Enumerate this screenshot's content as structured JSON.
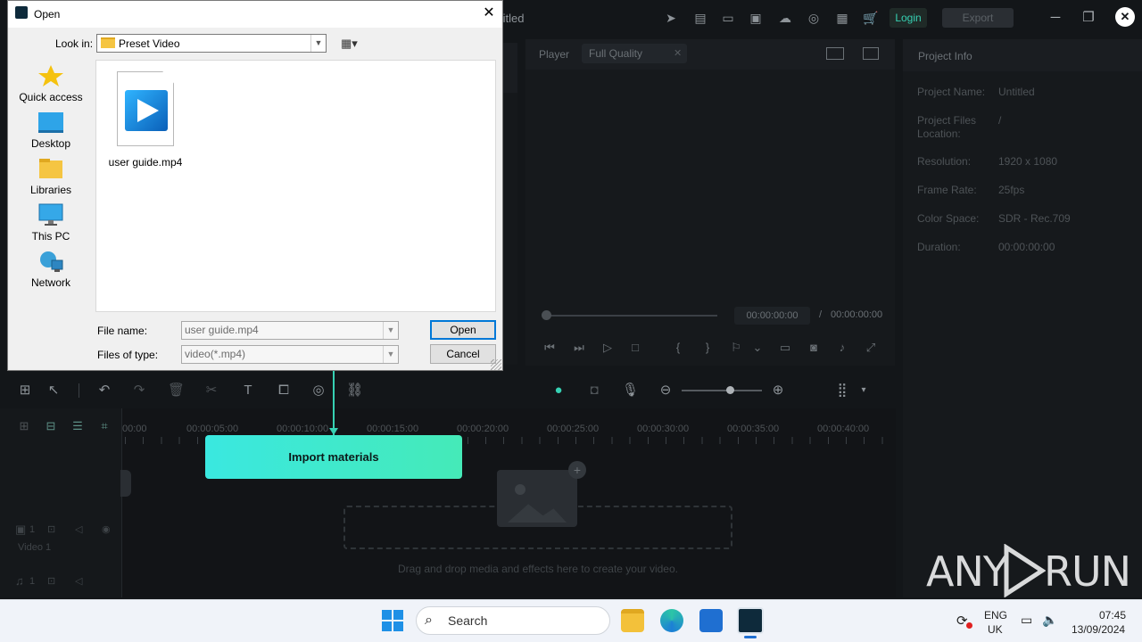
{
  "app": {
    "title_partial": "titled",
    "login_label": "Login",
    "export_label": "Export"
  },
  "player": {
    "label": "Player",
    "quality": "Full Quality",
    "current_time": "00:00:00:00",
    "separator": "/",
    "total_time": "00:00:00:00"
  },
  "project_info": {
    "title": "Project Info",
    "rows": [
      {
        "key": "Project Name:",
        "value": "Untitled"
      },
      {
        "key": "Project Files Location:",
        "value": "/"
      },
      {
        "key": "Resolution:",
        "value": "1920 x 1080"
      },
      {
        "key": "Frame Rate:",
        "value": "25fps"
      },
      {
        "key": "Color Space:",
        "value": "SDR - Rec.709"
      },
      {
        "key": "Duration:",
        "value": "00:00:00:00"
      }
    ]
  },
  "timeline": {
    "ruler": [
      "00:00",
      "00:00:05:00",
      "00:00:10:00",
      "00:00:15:00",
      "00:00:20:00",
      "00:00:25:00",
      "00:00:30:00",
      "00:00:35:00",
      "00:00:40:00"
    ],
    "import_tooltip": "Import materials",
    "drop_hint": "Drag and drop media and effects here to create your video.",
    "video_track_label": "Video 1",
    "video_track_num": "1",
    "audio_track_num": "1"
  },
  "dialog": {
    "title": "Open",
    "lookin_label": "Look in:",
    "lookin_value": "Preset Video",
    "places": [
      "Quick access",
      "Desktop",
      "Libraries",
      "This PC",
      "Network"
    ],
    "file": {
      "name": "user guide.mp4"
    },
    "filename_label": "File name:",
    "filename_value": "user guide.mp4",
    "filetype_label": "Files of type:",
    "filetype_value": "video(*.mp4)",
    "open_label": "Open",
    "cancel_label": "Cancel"
  },
  "taskbar": {
    "search_label": "Search",
    "lang_top": "ENG",
    "lang_bottom": "UK",
    "time": "07:45",
    "date": "13/09/2024"
  },
  "watermark": {
    "left": "ANY",
    "right": "RUN"
  },
  "colors": {
    "accent": "#36d1b3",
    "tooltip_start": "#3ae8e0",
    "tooltip_end": "#45eab8"
  }
}
